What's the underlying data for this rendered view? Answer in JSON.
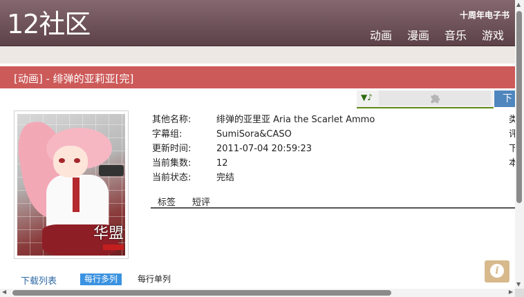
{
  "header": {
    "logo": "12社区",
    "anniversary_link": "十周年电子书",
    "nav": [
      "动画",
      "漫画",
      "音乐",
      "游戏"
    ]
  },
  "page": {
    "title": "[动画] - 绯弹的亚莉亚[完]"
  },
  "player": {
    "music_icon": "▼♪",
    "download_button_label": "下"
  },
  "details": [
    {
      "label": "其他名称:",
      "value": "绯弹的亚里亚 Aria the Scarlet Ammo"
    },
    {
      "label": "字幕组:",
      "value": "SumiSora&CASO"
    },
    {
      "label": "更新时间:",
      "value": "2011-07-04 20:59:23"
    },
    {
      "label": "当前集数:",
      "value": "12"
    },
    {
      "label": "当前状态:",
      "value": "完结"
    }
  ],
  "right_column_partial": [
    "类",
    "评",
    "下",
    "本"
  ],
  "cover": {
    "watermark": "华盟"
  },
  "tabs": [
    "标签",
    "短评"
  ],
  "downloads": {
    "list_label": "下载列表",
    "multi_per_row": "每行多列",
    "single_per_row": "每行单列"
  },
  "info_button_icon": "i",
  "scrollbars": {
    "up": "▲",
    "down": "▼",
    "left": "◀",
    "right": "▶"
  },
  "colors": {
    "header": "#6f545b",
    "title_bar": "#cc5a59",
    "download_button": "#4f86bd",
    "multi_button": "#3a92e0",
    "info_button": "#d7b98c"
  }
}
